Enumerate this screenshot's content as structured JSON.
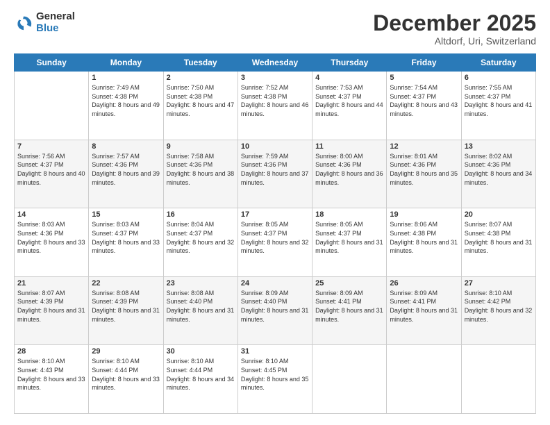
{
  "logo": {
    "general": "General",
    "blue": "Blue"
  },
  "header": {
    "month": "December 2025",
    "location": "Altdorf, Uri, Switzerland"
  },
  "weekdays": [
    "Sunday",
    "Monday",
    "Tuesday",
    "Wednesday",
    "Thursday",
    "Friday",
    "Saturday"
  ],
  "weeks": [
    [
      {
        "day": "",
        "sunrise": "",
        "sunset": "",
        "daylight": ""
      },
      {
        "day": "1",
        "sunrise": "Sunrise: 7:49 AM",
        "sunset": "Sunset: 4:38 PM",
        "daylight": "Daylight: 8 hours and 49 minutes."
      },
      {
        "day": "2",
        "sunrise": "Sunrise: 7:50 AM",
        "sunset": "Sunset: 4:38 PM",
        "daylight": "Daylight: 8 hours and 47 minutes."
      },
      {
        "day": "3",
        "sunrise": "Sunrise: 7:52 AM",
        "sunset": "Sunset: 4:38 PM",
        "daylight": "Daylight: 8 hours and 46 minutes."
      },
      {
        "day": "4",
        "sunrise": "Sunrise: 7:53 AM",
        "sunset": "Sunset: 4:37 PM",
        "daylight": "Daylight: 8 hours and 44 minutes."
      },
      {
        "day": "5",
        "sunrise": "Sunrise: 7:54 AM",
        "sunset": "Sunset: 4:37 PM",
        "daylight": "Daylight: 8 hours and 43 minutes."
      },
      {
        "day": "6",
        "sunrise": "Sunrise: 7:55 AM",
        "sunset": "Sunset: 4:37 PM",
        "daylight": "Daylight: 8 hours and 41 minutes."
      }
    ],
    [
      {
        "day": "7",
        "sunrise": "Sunrise: 7:56 AM",
        "sunset": "Sunset: 4:37 PM",
        "daylight": "Daylight: 8 hours and 40 minutes."
      },
      {
        "day": "8",
        "sunrise": "Sunrise: 7:57 AM",
        "sunset": "Sunset: 4:36 PM",
        "daylight": "Daylight: 8 hours and 39 minutes."
      },
      {
        "day": "9",
        "sunrise": "Sunrise: 7:58 AM",
        "sunset": "Sunset: 4:36 PM",
        "daylight": "Daylight: 8 hours and 38 minutes."
      },
      {
        "day": "10",
        "sunrise": "Sunrise: 7:59 AM",
        "sunset": "Sunset: 4:36 PM",
        "daylight": "Daylight: 8 hours and 37 minutes."
      },
      {
        "day": "11",
        "sunrise": "Sunrise: 8:00 AM",
        "sunset": "Sunset: 4:36 PM",
        "daylight": "Daylight: 8 hours and 36 minutes."
      },
      {
        "day": "12",
        "sunrise": "Sunrise: 8:01 AM",
        "sunset": "Sunset: 4:36 PM",
        "daylight": "Daylight: 8 hours and 35 minutes."
      },
      {
        "day": "13",
        "sunrise": "Sunrise: 8:02 AM",
        "sunset": "Sunset: 4:36 PM",
        "daylight": "Daylight: 8 hours and 34 minutes."
      }
    ],
    [
      {
        "day": "14",
        "sunrise": "Sunrise: 8:03 AM",
        "sunset": "Sunset: 4:36 PM",
        "daylight": "Daylight: 8 hours and 33 minutes."
      },
      {
        "day": "15",
        "sunrise": "Sunrise: 8:03 AM",
        "sunset": "Sunset: 4:37 PM",
        "daylight": "Daylight: 8 hours and 33 minutes."
      },
      {
        "day": "16",
        "sunrise": "Sunrise: 8:04 AM",
        "sunset": "Sunset: 4:37 PM",
        "daylight": "Daylight: 8 hours and 32 minutes."
      },
      {
        "day": "17",
        "sunrise": "Sunrise: 8:05 AM",
        "sunset": "Sunset: 4:37 PM",
        "daylight": "Daylight: 8 hours and 32 minutes."
      },
      {
        "day": "18",
        "sunrise": "Sunrise: 8:05 AM",
        "sunset": "Sunset: 4:37 PM",
        "daylight": "Daylight: 8 hours and 31 minutes."
      },
      {
        "day": "19",
        "sunrise": "Sunrise: 8:06 AM",
        "sunset": "Sunset: 4:38 PM",
        "daylight": "Daylight: 8 hours and 31 minutes."
      },
      {
        "day": "20",
        "sunrise": "Sunrise: 8:07 AM",
        "sunset": "Sunset: 4:38 PM",
        "daylight": "Daylight: 8 hours and 31 minutes."
      }
    ],
    [
      {
        "day": "21",
        "sunrise": "Sunrise: 8:07 AM",
        "sunset": "Sunset: 4:39 PM",
        "daylight": "Daylight: 8 hours and 31 minutes."
      },
      {
        "day": "22",
        "sunrise": "Sunrise: 8:08 AM",
        "sunset": "Sunset: 4:39 PM",
        "daylight": "Daylight: 8 hours and 31 minutes."
      },
      {
        "day": "23",
        "sunrise": "Sunrise: 8:08 AM",
        "sunset": "Sunset: 4:40 PM",
        "daylight": "Daylight: 8 hours and 31 minutes."
      },
      {
        "day": "24",
        "sunrise": "Sunrise: 8:09 AM",
        "sunset": "Sunset: 4:40 PM",
        "daylight": "Daylight: 8 hours and 31 minutes."
      },
      {
        "day": "25",
        "sunrise": "Sunrise: 8:09 AM",
        "sunset": "Sunset: 4:41 PM",
        "daylight": "Daylight: 8 hours and 31 minutes."
      },
      {
        "day": "26",
        "sunrise": "Sunrise: 8:09 AM",
        "sunset": "Sunset: 4:41 PM",
        "daylight": "Daylight: 8 hours and 31 minutes."
      },
      {
        "day": "27",
        "sunrise": "Sunrise: 8:10 AM",
        "sunset": "Sunset: 4:42 PM",
        "daylight": "Daylight: 8 hours and 32 minutes."
      }
    ],
    [
      {
        "day": "28",
        "sunrise": "Sunrise: 8:10 AM",
        "sunset": "Sunset: 4:43 PM",
        "daylight": "Daylight: 8 hours and 33 minutes."
      },
      {
        "day": "29",
        "sunrise": "Sunrise: 8:10 AM",
        "sunset": "Sunset: 4:44 PM",
        "daylight": "Daylight: 8 hours and 33 minutes."
      },
      {
        "day": "30",
        "sunrise": "Sunrise: 8:10 AM",
        "sunset": "Sunset: 4:44 PM",
        "daylight": "Daylight: 8 hours and 34 minutes."
      },
      {
        "day": "31",
        "sunrise": "Sunrise: 8:10 AM",
        "sunset": "Sunset: 4:45 PM",
        "daylight": "Daylight: 8 hours and 35 minutes."
      },
      {
        "day": "",
        "sunrise": "",
        "sunset": "",
        "daylight": ""
      },
      {
        "day": "",
        "sunrise": "",
        "sunset": "",
        "daylight": ""
      },
      {
        "day": "",
        "sunrise": "",
        "sunset": "",
        "daylight": ""
      }
    ]
  ]
}
